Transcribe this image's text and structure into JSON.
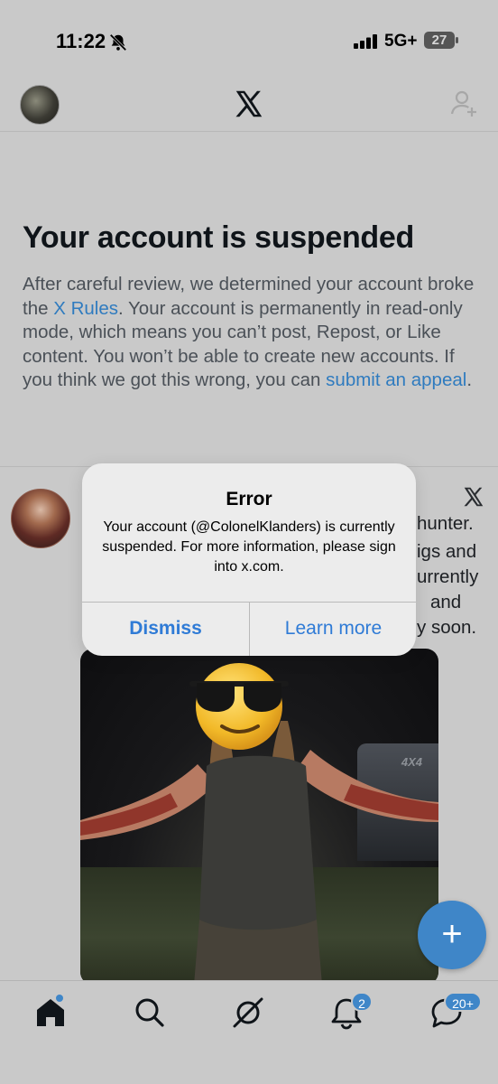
{
  "status_bar": {
    "time": "11:22",
    "network": "5G+",
    "battery": "27"
  },
  "top_nav": {
    "logo_icon": "x-logo-icon",
    "follow_icon": "add-user-icon"
  },
  "suspension": {
    "headline": "Your account is suspended",
    "text_1": "After careful review, we determined your account broke the ",
    "rules_link": "X Rules",
    "text_2": ". Your account is permanently in read-only mode, which means you can’t post, Repost, or Like content. You won’t be able to create new accounts. If you think we got this wrong, you can ",
    "appeal_link": "submit an appeal",
    "text_3": "."
  },
  "tweet": {
    "fragments": [
      "hunter.",
      "igs and",
      "urrently",
      "and",
      "y soon."
    ]
  },
  "dialog": {
    "title": "Error",
    "message": "Your account (@ColonelKlanders) is currently suspended. For more information, please sign into x.com.",
    "dismiss_label": "Dismiss",
    "learn_more_label": "Learn more"
  },
  "fab": {
    "label": "+"
  },
  "bottom_nav": {
    "items": [
      {
        "icon": "home-icon"
      },
      {
        "icon": "search-icon"
      },
      {
        "icon": "grok-icon"
      },
      {
        "icon": "notifications-icon",
        "badge": "2"
      },
      {
        "icon": "messages-icon",
        "badge": "20+"
      }
    ]
  },
  "colors": {
    "accent": "#3f86c8",
    "link": "#2f7bbf",
    "background": "#c9c9c9"
  }
}
